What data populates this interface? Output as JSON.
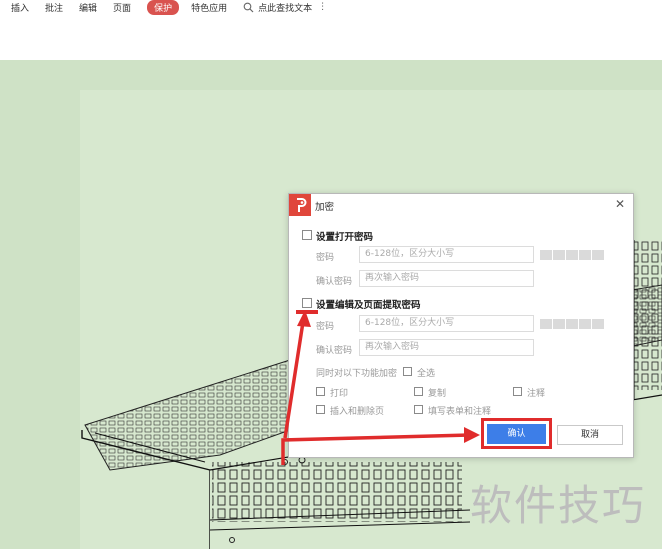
{
  "toolbar": {
    "tabs": [
      {
        "label": "插入"
      },
      {
        "label": "批注"
      },
      {
        "label": "编辑"
      },
      {
        "label": "页面"
      },
      {
        "label": "保护",
        "active": true
      },
      {
        "label": "特色应用"
      }
    ],
    "search_label": "点此查找文本",
    "more_icon": "⋮"
  },
  "dialog": {
    "title": "加密",
    "close_icon": "✕",
    "open_pwd": {
      "checkbox_label": "设置打开密码",
      "pwd_label": "密码",
      "pwd_placeholder": "6-128位，区分大小写",
      "confirm_label": "确认密码",
      "confirm_placeholder": "再次输入密码"
    },
    "edit_pwd": {
      "checkbox_label": "设置编辑及页面提取密码",
      "pwd_label": "密码",
      "pwd_placeholder": "6-128位，区分大小写",
      "confirm_label": "确认密码",
      "confirm_placeholder": "再次输入密码"
    },
    "encrypt_features_label": "同时对以下功能加密",
    "select_all_label": "全选",
    "options": {
      "print": "打印",
      "copy": "复制",
      "annotate": "注释",
      "insert_delete": "插入和删除页",
      "fill_form": "填写表单和注释"
    },
    "ok_label": "确认",
    "cancel_label": "取消"
  },
  "watermark": "软件技巧",
  "colors": {
    "accent_red": "#e02c2c",
    "confirm_blue": "#3d7ee8",
    "logo_red": "#e0463b",
    "canvas_green": "#cfe2c6"
  }
}
